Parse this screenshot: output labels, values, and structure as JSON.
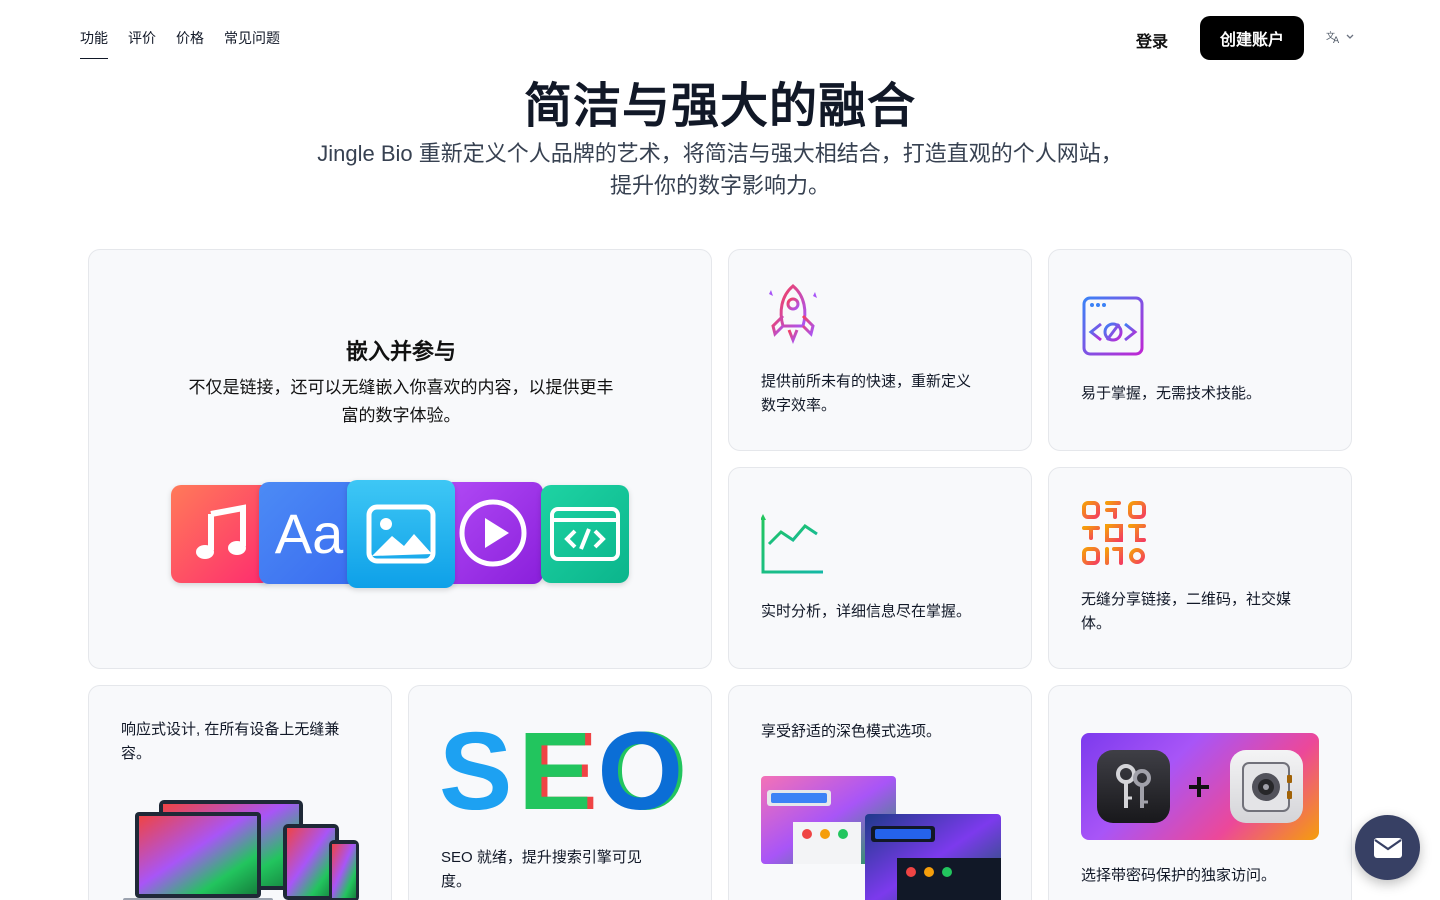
{
  "nav": {
    "links": [
      "功能",
      "评价",
      "价格",
      "常见问题"
    ],
    "login_label": "登录",
    "signup_label": "创建账户",
    "language_icon": "translate-icon"
  },
  "hero": {
    "title": "简洁与强大的融合",
    "subtitle_line1": "Jingle Bio 重新定义个人品牌的艺术，将简洁与强大相结合，打造直观的个人网站，",
    "subtitle_line2": "提升你的数字影响力。"
  },
  "features": {
    "embed": {
      "title": "嵌入并参与",
      "desc_line1": "不仅是链接，还可以无缝嵌入你喜欢的内容，以提供更丰",
      "desc_line2": "富的数字体验。",
      "tile_text": "Aa"
    },
    "speed": {
      "line1": "提供前所未有的快速，重新定义",
      "line2": "数字效率。",
      "icon": "rocket-icon"
    },
    "easy": {
      "text": "易于掌握，无需技术技能。",
      "icon": "code-window-icon"
    },
    "analytics": {
      "text": "实时分析，详细信息尽在掌握。",
      "icon": "bar-chart-icon"
    },
    "share": {
      "line1": "无缝分享链接，二维码，社交媒",
      "line2": "体。",
      "icon": "qr-code-icon"
    },
    "responsive": {
      "line1": "响应式设计, 在所有设备上无缝兼",
      "line2": "容。"
    },
    "seo": {
      "logo_letters": [
        "S",
        "E",
        "O"
      ],
      "line1": "SEO 就绪，提升搜索引擎可见",
      "line2": "度。"
    },
    "dark": {
      "text": "享受舒适的深色模式选项。"
    },
    "password": {
      "text": "选择带密码保护的独家访问。"
    }
  },
  "colors": {
    "primary": "#000000",
    "card_bg": "#f8f9fb",
    "card_border": "#e5e7eb",
    "fab": "#374064"
  }
}
